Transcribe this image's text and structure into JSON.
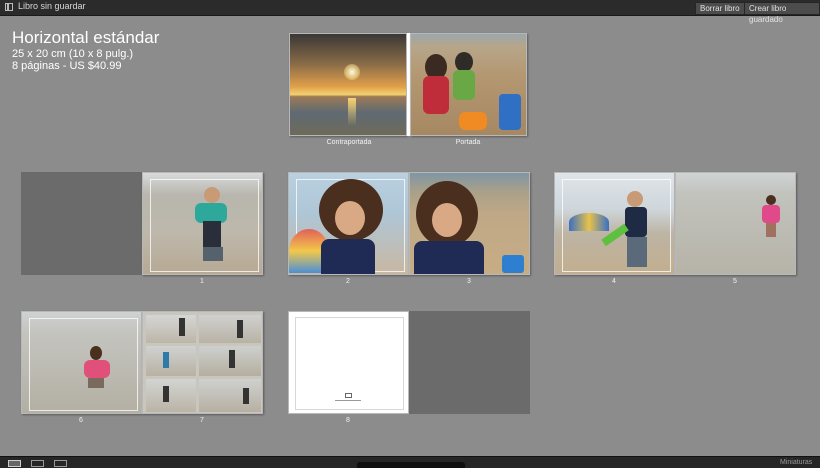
{
  "titlebar": {
    "title": "Libro sin guardar",
    "clear_label": "Borrar libro",
    "create_label": "Crear libro guardado"
  },
  "book": {
    "format": "Horizontal estándar",
    "size": "25 x 20 cm (10 x 8 pulg.)",
    "pages_price": "8 páginas - US $40.99"
  },
  "cover": {
    "back_label": "Contraportada",
    "front_label": "Portada"
  },
  "pages": [
    "1",
    "2",
    "3",
    "4",
    "5",
    "6",
    "7",
    "8"
  ],
  "bottombar": {
    "size_label": "Miniaturas"
  }
}
